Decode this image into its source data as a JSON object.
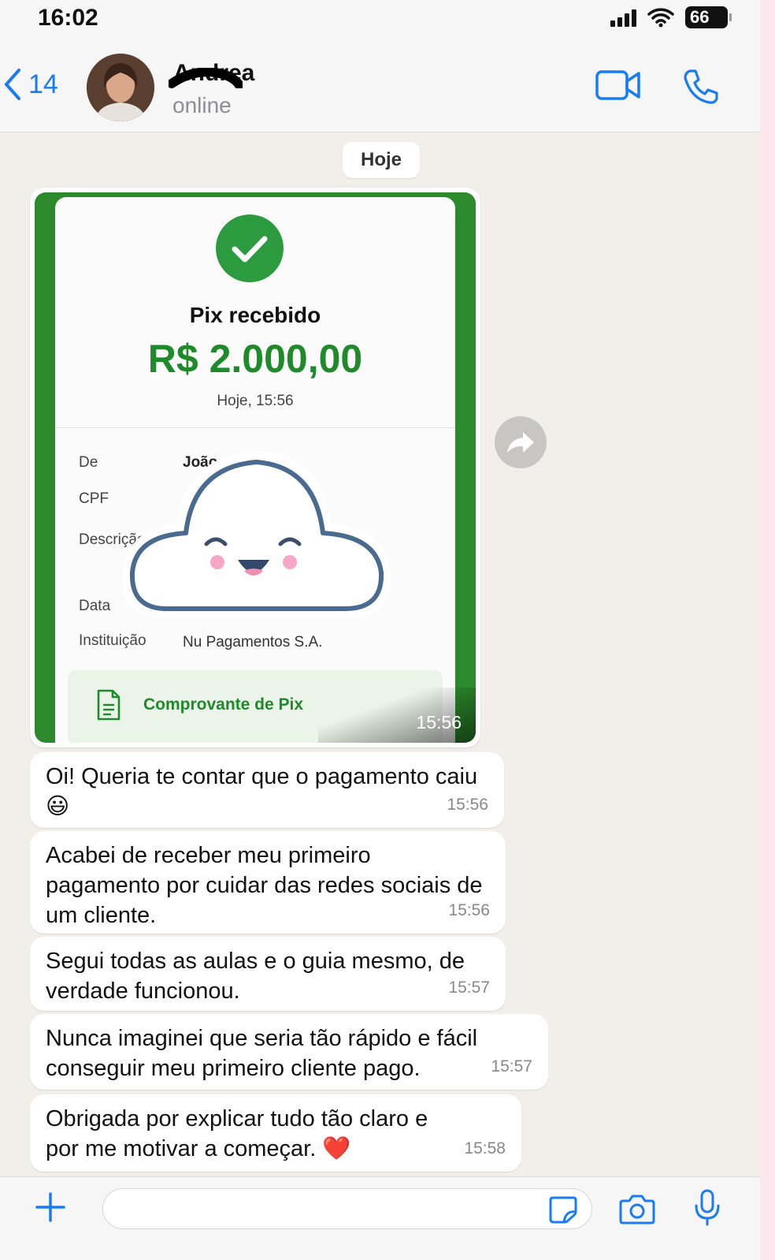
{
  "status_bar": {
    "time": "16:02",
    "battery": "66"
  },
  "header": {
    "back_count": "14",
    "contact_name": "Andrea",
    "contact_status": "online"
  },
  "date_divider": "Hoje",
  "receipt": {
    "title": "Pix recebido",
    "amount": "R$ 2.000,00",
    "date": "Hoje, 15:56",
    "rows": [
      {
        "label": "De",
        "value": "João"
      },
      {
        "label": "CPF",
        "value": ""
      },
      {
        "label": "Descrição",
        "value": ""
      },
      {
        "label": "Data",
        "value": ""
      },
      {
        "label": "Instituição",
        "value": "Nu Pagamentos S.A."
      }
    ],
    "doc_label": "Comprovante de Pix",
    "time": "15:56"
  },
  "messages": [
    {
      "text": "Oi! Queria te contar que o pagamento caiu 😃",
      "time": "15:56"
    },
    {
      "text": "Acabei de receber meu primeiro pagamento por cuidar das redes sociais de um cliente.",
      "time": "15:56"
    },
    {
      "text": "Segui todas as aulas e o guia mesmo, de verdade funcionou.",
      "time": "15:57"
    },
    {
      "text": "Nunca imaginei que seria tão rápido e fácil conseguir meu primeiro cliente pago.",
      "time": "15:57"
    },
    {
      "text": "Obrigada por explicar tudo tão claro e por me motivar a começar. ❤️",
      "time": "15:58"
    }
  ],
  "colors": {
    "accent": "#1a7cf5",
    "pix_green": "#1f8a2a",
    "chat_bg": "#f2efea"
  },
  "icons": {
    "back": "chevron-left-icon",
    "video": "video-camera-icon",
    "call": "phone-icon",
    "forward": "forward-arrow-icon",
    "plus": "plus-icon",
    "sticker": "sticker-icon",
    "camera": "camera-icon",
    "mic": "microphone-icon"
  }
}
